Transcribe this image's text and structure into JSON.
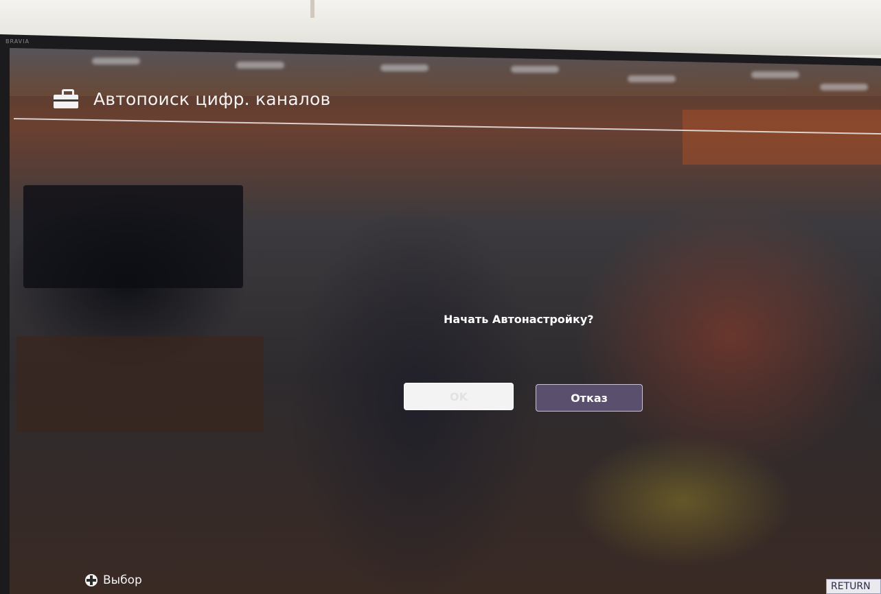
{
  "header": {
    "icon": "toolbox-icon",
    "title": "Автопоиск цифр. каналов"
  },
  "dialog": {
    "prompt": "Начать Автонастройку?",
    "ok_label": "OK",
    "cancel_label": "Отказ"
  },
  "footer": {
    "select_icon": "dpad-icon",
    "select_label": "Выбор",
    "return_label": "RETURN"
  },
  "brand": "BRAVIA",
  "colors": {
    "cancel_button_bg": "#5a4f6c",
    "ok_button_bg": "#f3f3f3",
    "text": "#ffffff"
  }
}
